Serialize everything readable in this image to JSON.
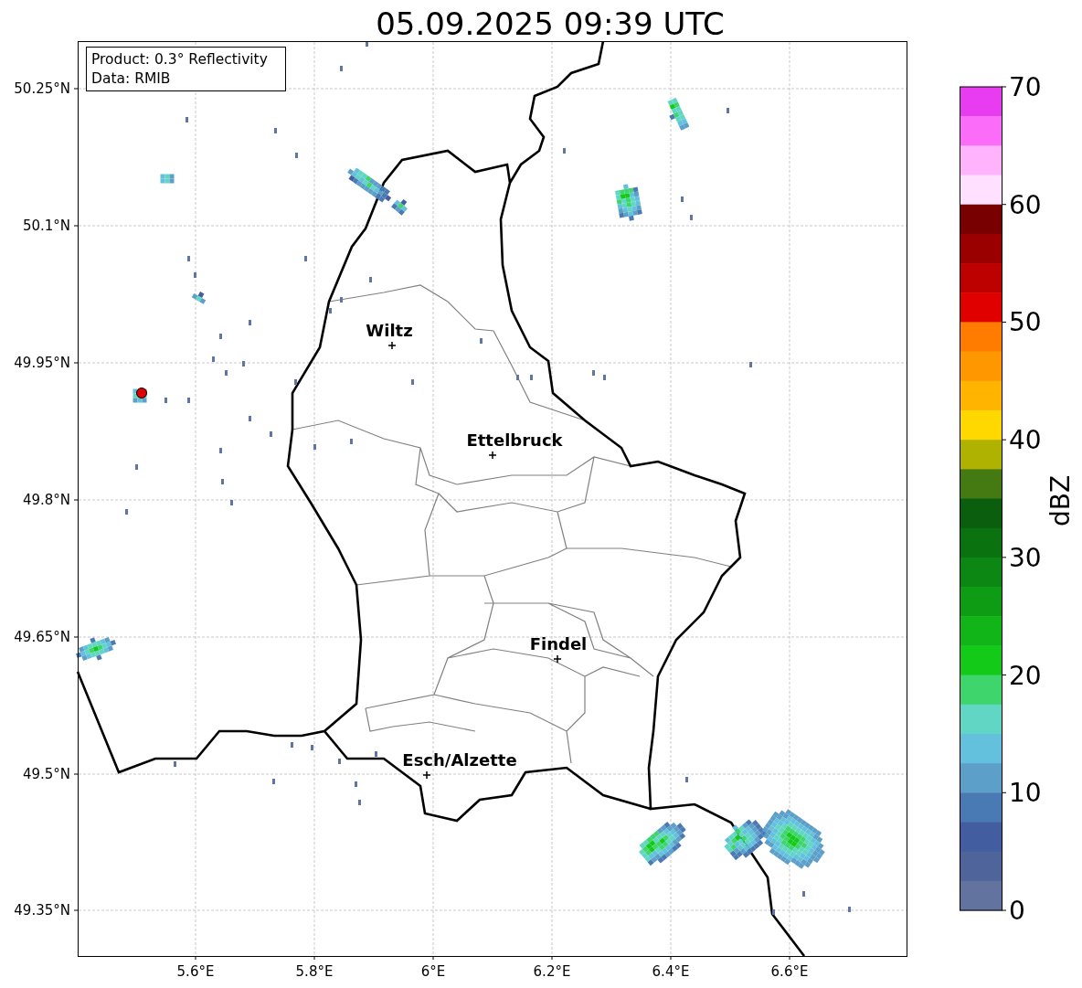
{
  "title": "05.09.2025 09:39 UTC",
  "info_box": {
    "lines": [
      "Product: 0.3° Reflectivity",
      "Data: RMIB"
    ]
  },
  "map": {
    "xticks": [
      "5.6°E",
      "5.8°E",
      "6°E",
      "6.2°E",
      "6.4°E",
      "6.6°E"
    ],
    "yticks": [
      "50.25°N",
      "50.1°N",
      "49.95°N",
      "49.8°N",
      "49.65°N",
      "49.5°N",
      "49.35°N"
    ],
    "cities": [
      {
        "name": "Wiltz"
      },
      {
        "name": "Ettelbruck"
      },
      {
        "name": "Findel"
      },
      {
        "name": "Esch/Alzette"
      }
    ]
  },
  "colorbar": {
    "label": "dBZ",
    "ticks": [
      "70",
      "60",
      "50",
      "40",
      "30",
      "20",
      "10",
      "0"
    ],
    "segments": [
      {
        "color": "#e83cf0"
      },
      {
        "color": "#fb6cf8"
      },
      {
        "color": "#ffb3fd"
      },
      {
        "color": "#ffe0fe"
      },
      {
        "color": "#780000"
      },
      {
        "color": "#9a0000"
      },
      {
        "color": "#bd0000"
      },
      {
        "color": "#e00000"
      },
      {
        "color": "#ff7c00"
      },
      {
        "color": "#ff9800"
      },
      {
        "color": "#ffb400"
      },
      {
        "color": "#ffd800"
      },
      {
        "color": "#b0b200"
      },
      {
        "color": "#457a12"
      },
      {
        "color": "#0a5e0e"
      },
      {
        "color": "#0b7210"
      },
      {
        "color": "#0d8714"
      },
      {
        "color": "#0f9c15"
      },
      {
        "color": "#11b517"
      },
      {
        "color": "#13ca19"
      },
      {
        "color": "#3ed66c"
      },
      {
        "color": "#62d6c4"
      },
      {
        "color": "#64c1de"
      },
      {
        "color": "#5c9fc8"
      },
      {
        "color": "#4a7ab3"
      },
      {
        "color": "#425ea0"
      },
      {
        "color": "#4f649b"
      },
      {
        "color": "#62739f"
      }
    ]
  }
}
